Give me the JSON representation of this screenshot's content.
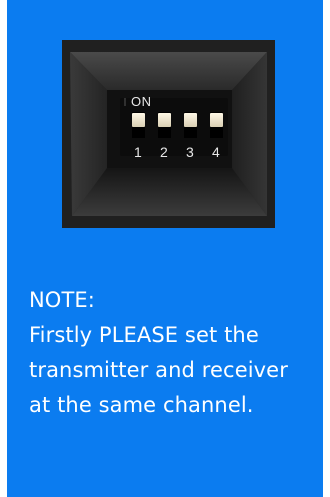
{
  "dip_switch": {
    "on_label": "ON",
    "switch_numbers": [
      "1",
      "2",
      "3",
      "4"
    ],
    "positions": [
      "on",
      "on",
      "on",
      "on"
    ]
  },
  "note": {
    "heading": "NOTE:",
    "lines": [
      "Firstly PLEASE set the",
      "transmitter and receiver",
      "at the same channel."
    ]
  },
  "colors": {
    "background": "#0b7cf0",
    "text": "#ffffff"
  }
}
